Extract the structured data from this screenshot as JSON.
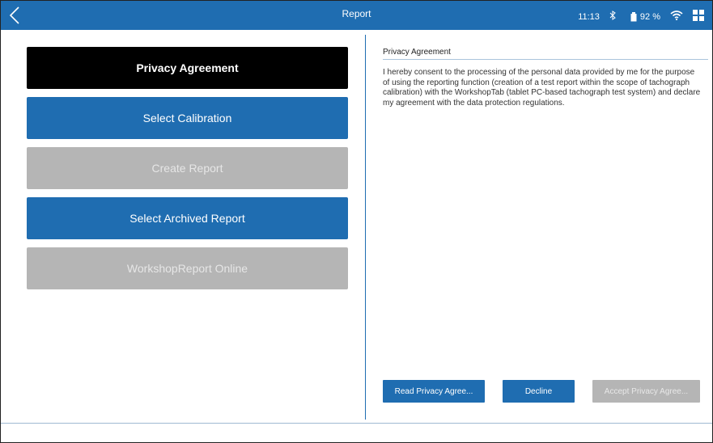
{
  "header": {
    "title": "Report",
    "time": "11:13",
    "battery": "92 %"
  },
  "menu": {
    "items": [
      {
        "label": "Privacy Agreement",
        "state": "active"
      },
      {
        "label": "Select Calibration",
        "state": "enabled"
      },
      {
        "label": "Create Report",
        "state": "disabled"
      },
      {
        "label": "Select Archived Report",
        "state": "enabled"
      },
      {
        "label": "WorkshopReport Online",
        "state": "disabled"
      }
    ]
  },
  "panel": {
    "heading": "Privacy Agreement",
    "text": "I hereby consent to the processing of the personal data provided by me for the purpose of using the reporting function (creation of a test report within the scope of tachograph calibration) with the WorkshopTab (tablet PC-based tachograph test system) and declare my agreement with the data protection regulations.",
    "buttons": {
      "read": "Read Privacy Agree...",
      "decline": "Decline",
      "accept": "Accept Privacy Agree..."
    }
  },
  "colors": {
    "accent": "#1f6db1",
    "active": "#000000",
    "disabled": "#b5b5b5"
  },
  "icons": {
    "back": "chevron-left-icon",
    "bluetooth": "bluetooth-icon",
    "battery": "battery-icon",
    "wifi": "wifi-icon",
    "grid": "grid-icon"
  }
}
